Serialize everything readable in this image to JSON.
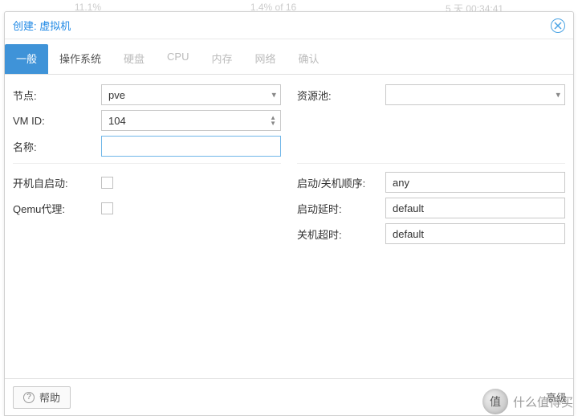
{
  "ghost": {
    "a": "11.1%",
    "b": "1.4% of 16",
    "c": "5 天 00:34:41"
  },
  "window": {
    "title": "创建: 虚拟机"
  },
  "tabs": {
    "general": "一般",
    "os": "操作系统",
    "disk": "硬盘",
    "cpu": "CPU",
    "memory": "内存",
    "network": "网络",
    "confirm": "确认"
  },
  "left": {
    "node_label": "节点:",
    "node_value": "pve",
    "vmid_label": "VM ID:",
    "vmid_value": "104",
    "name_label": "名称:",
    "name_value": "",
    "onboot_label": "开机自启动:",
    "qemu_agent_label": "Qemu代理:"
  },
  "right": {
    "pool_label": "资源池:",
    "pool_value": "",
    "order_label": "启动/关机顺序:",
    "order_value": "any",
    "up_delay_label": "启动延时:",
    "up_delay_value": "default",
    "down_timeout_label": "关机超时:",
    "down_timeout_value": "default"
  },
  "footer": {
    "help": "帮助",
    "advanced": "高级"
  },
  "watermark": {
    "text": "什么值得买"
  }
}
